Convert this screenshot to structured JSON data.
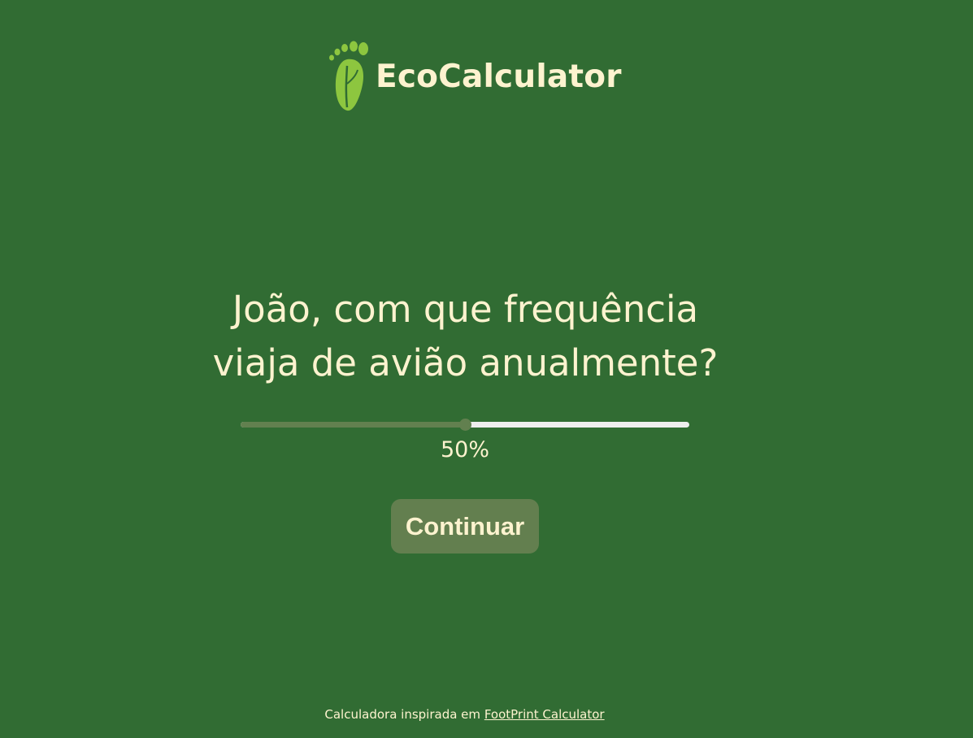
{
  "header": {
    "logo_icon": "footprint-leaf-icon",
    "brand_name": "EcoCalculator"
  },
  "question": {
    "line1": "João, com que frequência",
    "line2": "viaja de avião anualmente?"
  },
  "slider": {
    "value_fraction": 0.5,
    "value_label": "50%"
  },
  "actions": {
    "continue_label": "Continuar"
  },
  "footer": {
    "text": "Calculadora inspirada em",
    "link_text": "FootPrint Calculator"
  },
  "colors": {
    "background": "#316c33",
    "text": "#fdf3cf",
    "accent": "#62804f",
    "logo_green": "#8dc63f"
  }
}
